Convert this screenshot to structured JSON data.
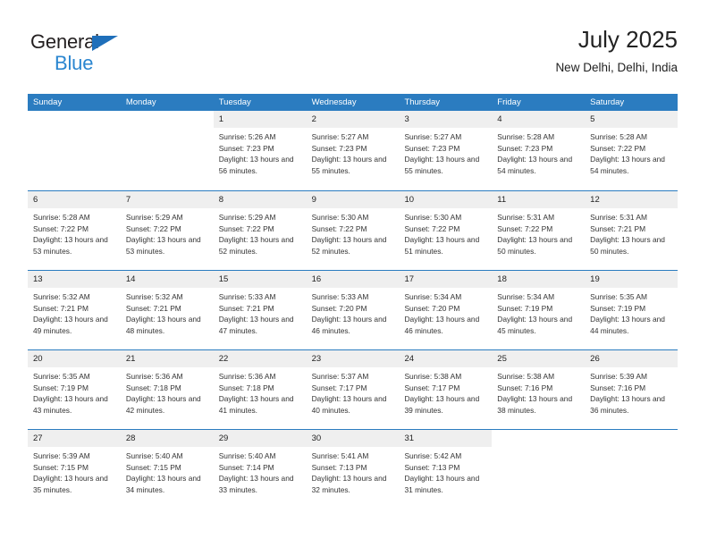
{
  "brand": {
    "line1": "General",
    "line2": "Blue",
    "accent": "#2b86d0",
    "triangle_color": "#1f6fba"
  },
  "header": {
    "title": "July 2025",
    "subtitle": "New Delhi, Delhi, India"
  },
  "calendar": {
    "header_bg": "#2b7cc0",
    "row_divider": "#2b7cc0",
    "daynum_band_bg": "#efefef",
    "weekdays": [
      "Sunday",
      "Monday",
      "Tuesday",
      "Wednesday",
      "Thursday",
      "Friday",
      "Saturday"
    ],
    "weeks": [
      [
        {
          "day": "",
          "sunrise": "",
          "sunset": "",
          "daylight": ""
        },
        {
          "day": "",
          "sunrise": "",
          "sunset": "",
          "daylight": ""
        },
        {
          "day": "1",
          "sunrise": "Sunrise: 5:26 AM",
          "sunset": "Sunset: 7:23 PM",
          "daylight": "Daylight: 13 hours and 56 minutes."
        },
        {
          "day": "2",
          "sunrise": "Sunrise: 5:27 AM",
          "sunset": "Sunset: 7:23 PM",
          "daylight": "Daylight: 13 hours and 55 minutes."
        },
        {
          "day": "3",
          "sunrise": "Sunrise: 5:27 AM",
          "sunset": "Sunset: 7:23 PM",
          "daylight": "Daylight: 13 hours and 55 minutes."
        },
        {
          "day": "4",
          "sunrise": "Sunrise: 5:28 AM",
          "sunset": "Sunset: 7:23 PM",
          "daylight": "Daylight: 13 hours and 54 minutes."
        },
        {
          "day": "5",
          "sunrise": "Sunrise: 5:28 AM",
          "sunset": "Sunset: 7:22 PM",
          "daylight": "Daylight: 13 hours and 54 minutes."
        }
      ],
      [
        {
          "day": "6",
          "sunrise": "Sunrise: 5:28 AM",
          "sunset": "Sunset: 7:22 PM",
          "daylight": "Daylight: 13 hours and 53 minutes."
        },
        {
          "day": "7",
          "sunrise": "Sunrise: 5:29 AM",
          "sunset": "Sunset: 7:22 PM",
          "daylight": "Daylight: 13 hours and 53 minutes."
        },
        {
          "day": "8",
          "sunrise": "Sunrise: 5:29 AM",
          "sunset": "Sunset: 7:22 PM",
          "daylight": "Daylight: 13 hours and 52 minutes."
        },
        {
          "day": "9",
          "sunrise": "Sunrise: 5:30 AM",
          "sunset": "Sunset: 7:22 PM",
          "daylight": "Daylight: 13 hours and 52 minutes."
        },
        {
          "day": "10",
          "sunrise": "Sunrise: 5:30 AM",
          "sunset": "Sunset: 7:22 PM",
          "daylight": "Daylight: 13 hours and 51 minutes."
        },
        {
          "day": "11",
          "sunrise": "Sunrise: 5:31 AM",
          "sunset": "Sunset: 7:22 PM",
          "daylight": "Daylight: 13 hours and 50 minutes."
        },
        {
          "day": "12",
          "sunrise": "Sunrise: 5:31 AM",
          "sunset": "Sunset: 7:21 PM",
          "daylight": "Daylight: 13 hours and 50 minutes."
        }
      ],
      [
        {
          "day": "13",
          "sunrise": "Sunrise: 5:32 AM",
          "sunset": "Sunset: 7:21 PM",
          "daylight": "Daylight: 13 hours and 49 minutes."
        },
        {
          "day": "14",
          "sunrise": "Sunrise: 5:32 AM",
          "sunset": "Sunset: 7:21 PM",
          "daylight": "Daylight: 13 hours and 48 minutes."
        },
        {
          "day": "15",
          "sunrise": "Sunrise: 5:33 AM",
          "sunset": "Sunset: 7:21 PM",
          "daylight": "Daylight: 13 hours and 47 minutes."
        },
        {
          "day": "16",
          "sunrise": "Sunrise: 5:33 AM",
          "sunset": "Sunset: 7:20 PM",
          "daylight": "Daylight: 13 hours and 46 minutes."
        },
        {
          "day": "17",
          "sunrise": "Sunrise: 5:34 AM",
          "sunset": "Sunset: 7:20 PM",
          "daylight": "Daylight: 13 hours and 46 minutes."
        },
        {
          "day": "18",
          "sunrise": "Sunrise: 5:34 AM",
          "sunset": "Sunset: 7:19 PM",
          "daylight": "Daylight: 13 hours and 45 minutes."
        },
        {
          "day": "19",
          "sunrise": "Sunrise: 5:35 AM",
          "sunset": "Sunset: 7:19 PM",
          "daylight": "Daylight: 13 hours and 44 minutes."
        }
      ],
      [
        {
          "day": "20",
          "sunrise": "Sunrise: 5:35 AM",
          "sunset": "Sunset: 7:19 PM",
          "daylight": "Daylight: 13 hours and 43 minutes."
        },
        {
          "day": "21",
          "sunrise": "Sunrise: 5:36 AM",
          "sunset": "Sunset: 7:18 PM",
          "daylight": "Daylight: 13 hours and 42 minutes."
        },
        {
          "day": "22",
          "sunrise": "Sunrise: 5:36 AM",
          "sunset": "Sunset: 7:18 PM",
          "daylight": "Daylight: 13 hours and 41 minutes."
        },
        {
          "day": "23",
          "sunrise": "Sunrise: 5:37 AM",
          "sunset": "Sunset: 7:17 PM",
          "daylight": "Daylight: 13 hours and 40 minutes."
        },
        {
          "day": "24",
          "sunrise": "Sunrise: 5:38 AM",
          "sunset": "Sunset: 7:17 PM",
          "daylight": "Daylight: 13 hours and 39 minutes."
        },
        {
          "day": "25",
          "sunrise": "Sunrise: 5:38 AM",
          "sunset": "Sunset: 7:16 PM",
          "daylight": "Daylight: 13 hours and 38 minutes."
        },
        {
          "day": "26",
          "sunrise": "Sunrise: 5:39 AM",
          "sunset": "Sunset: 7:16 PM",
          "daylight": "Daylight: 13 hours and 36 minutes."
        }
      ],
      [
        {
          "day": "27",
          "sunrise": "Sunrise: 5:39 AM",
          "sunset": "Sunset: 7:15 PM",
          "daylight": "Daylight: 13 hours and 35 minutes."
        },
        {
          "day": "28",
          "sunrise": "Sunrise: 5:40 AM",
          "sunset": "Sunset: 7:15 PM",
          "daylight": "Daylight: 13 hours and 34 minutes."
        },
        {
          "day": "29",
          "sunrise": "Sunrise: 5:40 AM",
          "sunset": "Sunset: 7:14 PM",
          "daylight": "Daylight: 13 hours and 33 minutes."
        },
        {
          "day": "30",
          "sunrise": "Sunrise: 5:41 AM",
          "sunset": "Sunset: 7:13 PM",
          "daylight": "Daylight: 13 hours and 32 minutes."
        },
        {
          "day": "31",
          "sunrise": "Sunrise: 5:42 AM",
          "sunset": "Sunset: 7:13 PM",
          "daylight": "Daylight: 13 hours and 31 minutes."
        },
        {
          "day": "",
          "sunrise": "",
          "sunset": "",
          "daylight": ""
        },
        {
          "day": "",
          "sunrise": "",
          "sunset": "",
          "daylight": ""
        }
      ]
    ]
  }
}
